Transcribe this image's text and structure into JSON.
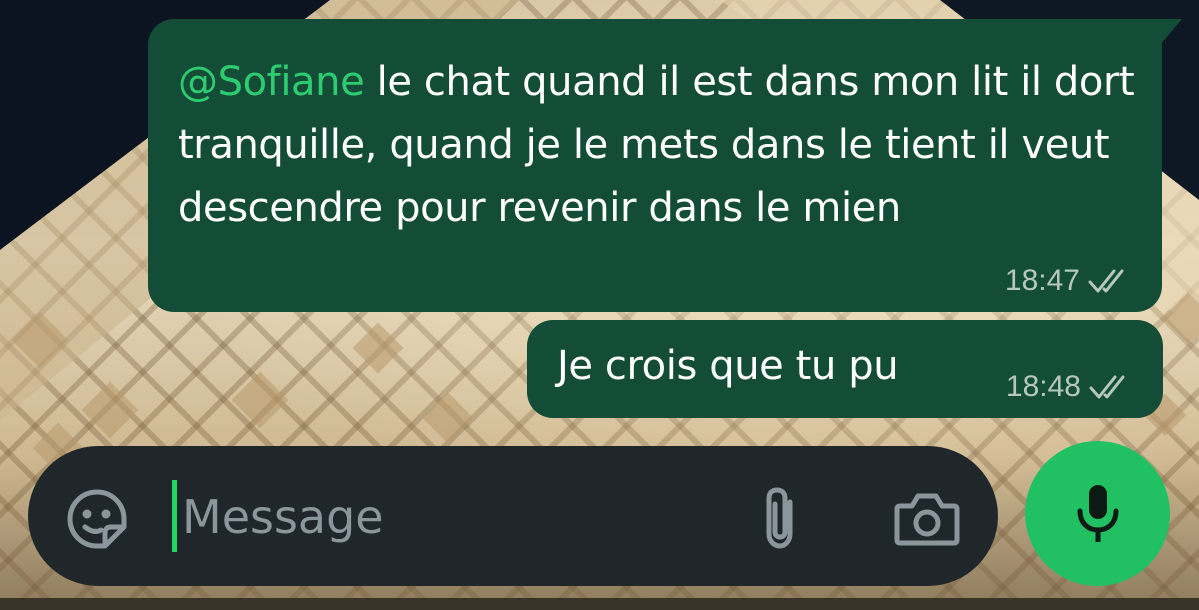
{
  "chat": {
    "messages": [
      {
        "mention": "@Sofiane",
        "text": " le chat quand il est dans mon lit il dort tranquille, quand je le mets dans le tient il veut descendre pour revenir dans le mien",
        "time": "18:47",
        "status": "double-check-icon"
      },
      {
        "text": "Je crois que tu pu",
        "time": "18:48",
        "status": "double-check-icon"
      }
    ]
  },
  "composer": {
    "placeholder": "Message",
    "icons": {
      "emoji": "sticker-icon",
      "attach": "paperclip-icon",
      "camera": "camera-icon",
      "send": "mic-icon"
    }
  },
  "colors": {
    "bubble_outgoing": "#134d37",
    "mention": "#2ecc71",
    "composer_bg": "#1f272b",
    "mic_button": "#21c063",
    "caret": "#25d366"
  }
}
